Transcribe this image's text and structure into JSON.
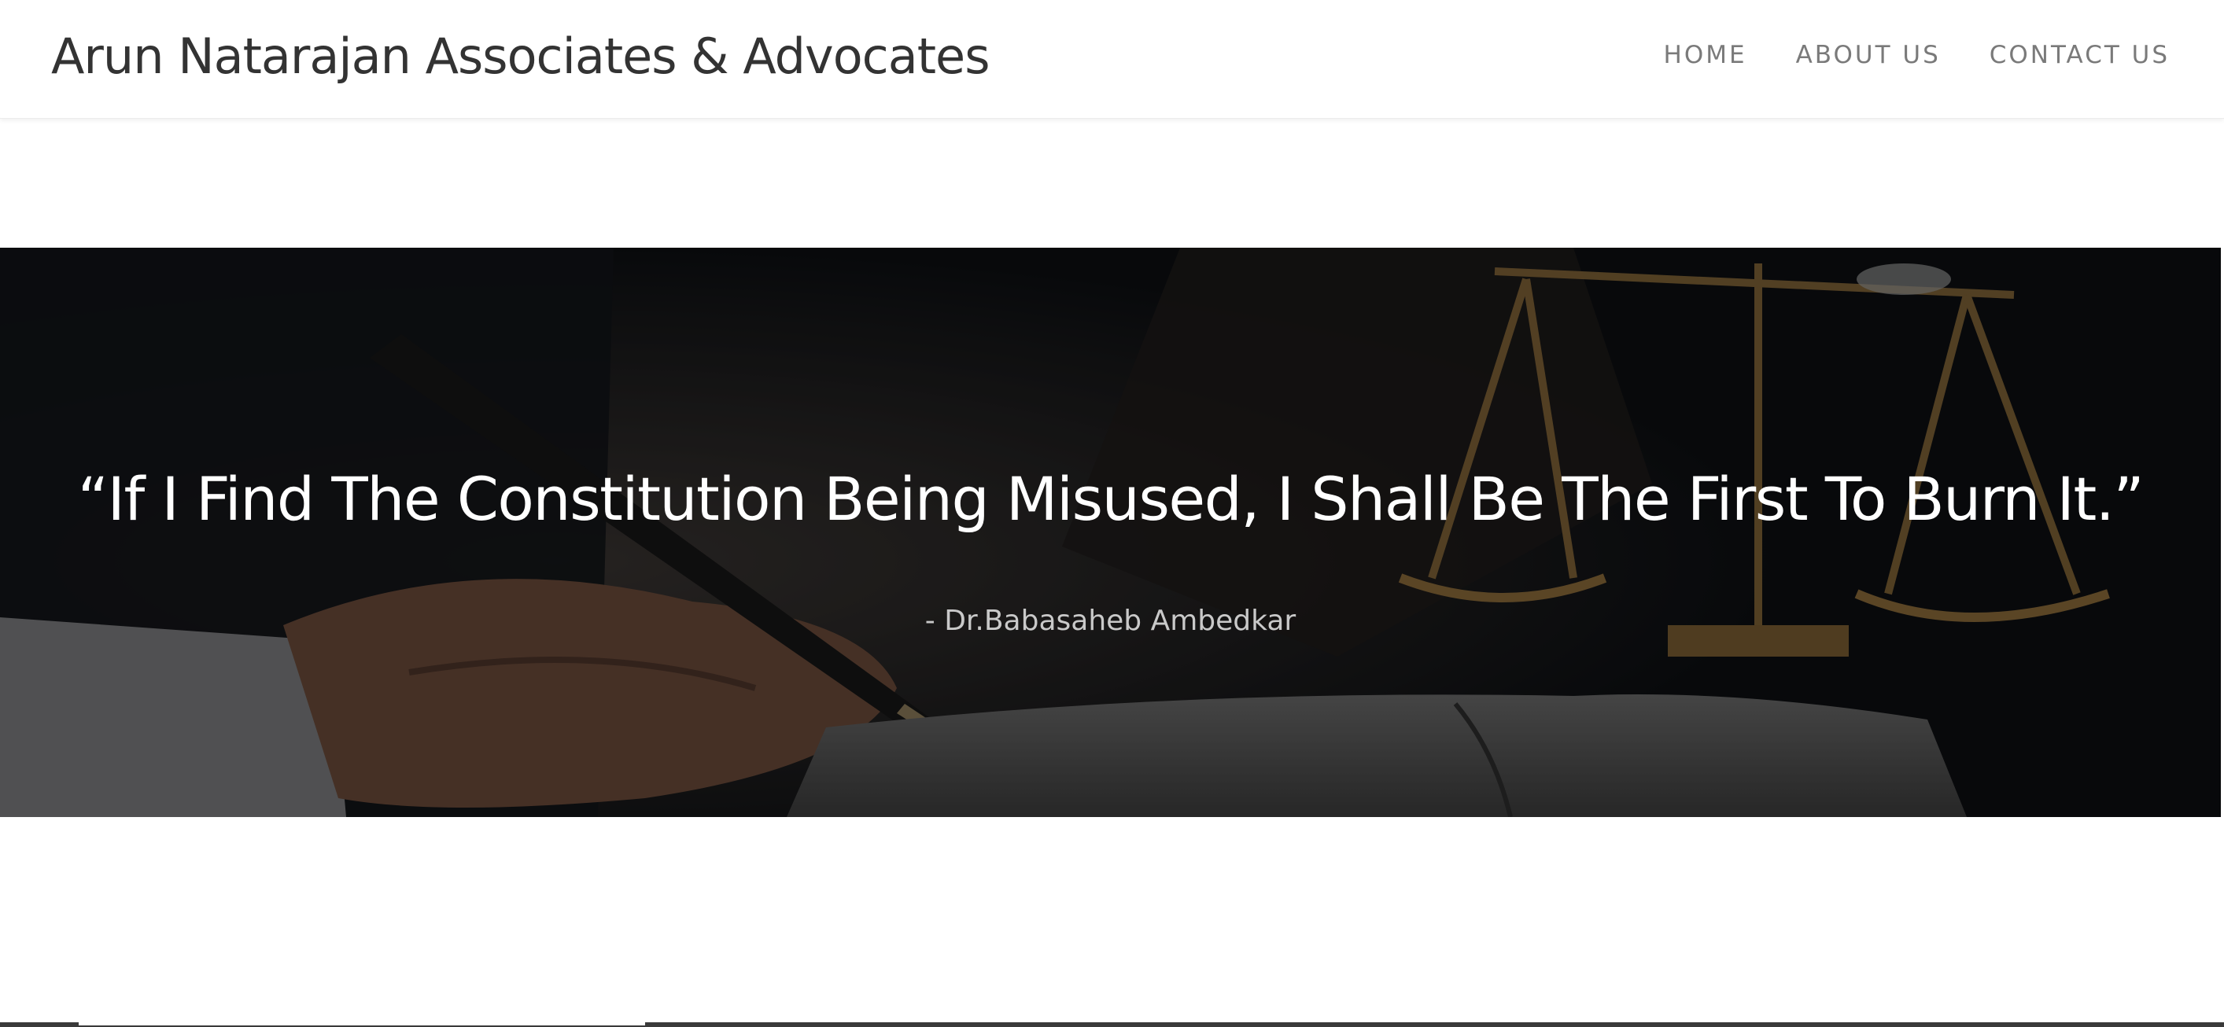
{
  "header": {
    "brand": "Arun Natarajan Associates & Advocates",
    "nav": [
      {
        "label": "HOME"
      },
      {
        "label": "ABOUT US"
      },
      {
        "label": "CONTACT US"
      }
    ]
  },
  "hero": {
    "quote": "“If I Find The Constitution Being Misused, I Shall Be The First To Burn It.”",
    "author": "- Dr.Babasaheb Ambedkar"
  },
  "colors": {
    "brand_text": "#333333",
    "nav_text": "#7a7a7a",
    "hero_overlay": "#0e1013",
    "quote_text": "#ffffff",
    "author_text": "#c9c9c9"
  }
}
